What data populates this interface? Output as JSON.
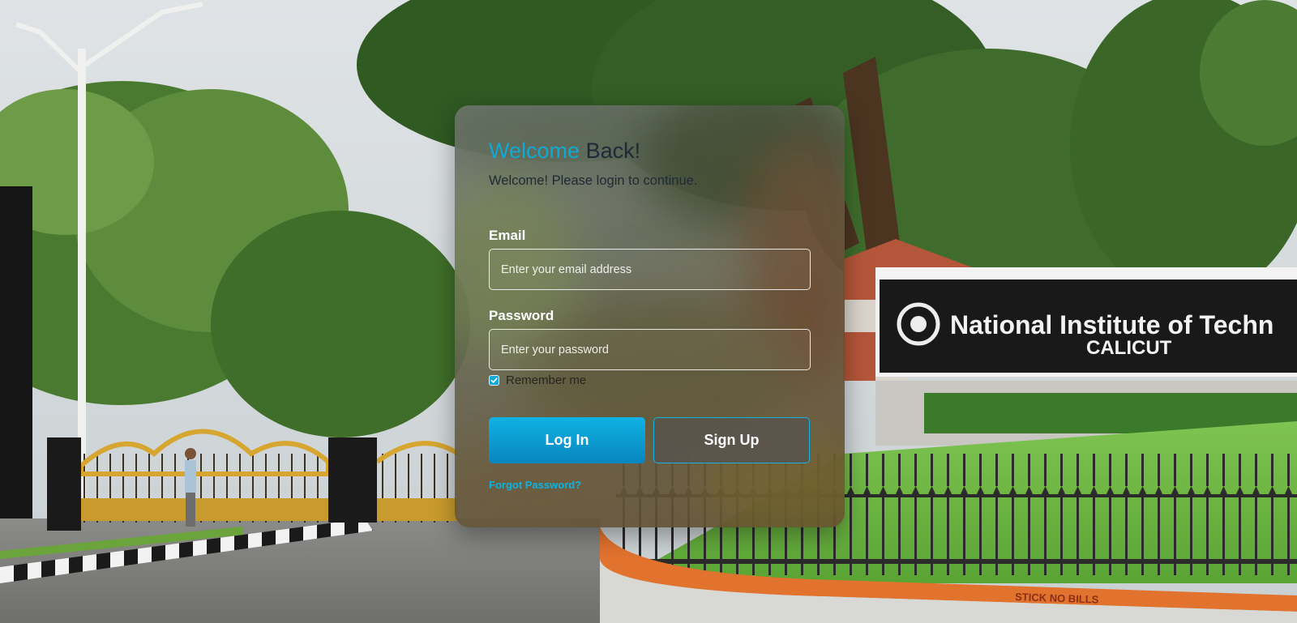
{
  "background": {
    "sign_line1": "National Institute of Techn",
    "sign_line2": "CALICUT",
    "wall_text": "STICK NO BILLS"
  },
  "login": {
    "title_accent": "Welcome",
    "title_rest": "Back!",
    "subtitle": "Welcome! Please login to continue.",
    "email_label": "Email",
    "email_value": "",
    "email_placeholder": "Enter your email address",
    "password_label": "Password",
    "password_value": "",
    "password_placeholder": "Enter your password",
    "remember_label": "Remember me",
    "remember_checked": true,
    "login_button": "Log In",
    "signup_button": "Sign Up",
    "forgot_link": "Forgot Password?"
  },
  "colors": {
    "accent": "#10a9d4",
    "login_button": "#0a9ad0",
    "link": "#0ab4e2"
  }
}
